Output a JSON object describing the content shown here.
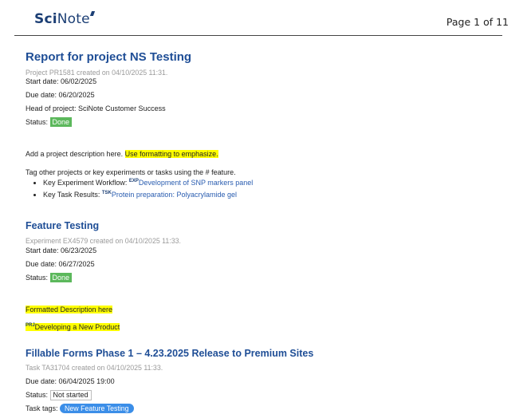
{
  "header": {
    "logo_bold": "Sci",
    "logo_rest": "Note",
    "page_label": "Page 1 of 11"
  },
  "project": {
    "title": "Report for project NS Testing",
    "meta": "Project PR1581 created on 04/10/2025 11:31.",
    "start_date": "Start date: 06/02/2025",
    "due_date": "Due date: 06/20/2025",
    "head": "Head of project: SciNote Customer Success",
    "status_label": "Status:",
    "status_value": "Done",
    "desc_text": "Add a project description here.",
    "desc_highlight": "Use formatting to emphasize.",
    "tag_intro": "Tag other projects or key experiments or tasks using the # feature.",
    "bullets": [
      {
        "label": "Key Experiment Workflow:",
        "sup": "EXP",
        "link": "Development of SNP markers panel"
      },
      {
        "label": "Key Task Results:",
        "sup": "TSK",
        "link": "Protein preparation: Polyacrylamide gel"
      }
    ]
  },
  "experiment": {
    "title": "Feature Testing",
    "meta": "Experiment EX4579 created on 04/10/2025 11:33.",
    "start_date": "Start date: 06/23/2025",
    "due_date": "Due date: 06/27/2025",
    "status_label": "Status:",
    "status_value": "Done",
    "formatted_desc": "Formatted Description here",
    "project_sup": "PRJ",
    "project_link": "Developing a New Product"
  },
  "task": {
    "title": "Fillable Forms Phase 1 – 4.23.2025 Release to Premium Sites",
    "meta": "Task TA31704 created on 04/10/2025 11:33.",
    "due_date": "Due date: 06/04/2025 19:00",
    "status_label": "Status:",
    "status_value": "Not started",
    "tags_label": "Task tags:",
    "tag": "New Feature Testing"
  },
  "colors": {
    "heading": "#1f4e96",
    "done_badge": "#5cb85c",
    "highlight": "#ffff00",
    "tag": "#3b8ee8"
  }
}
